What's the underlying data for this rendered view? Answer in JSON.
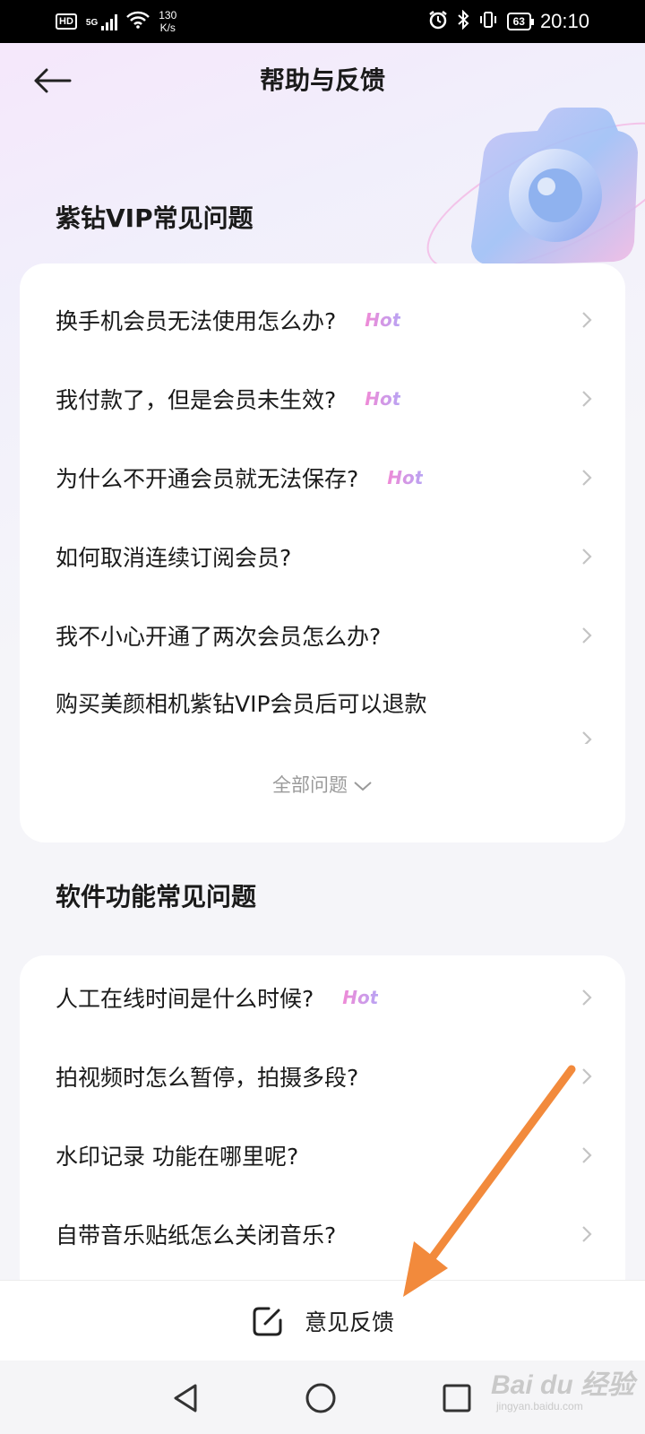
{
  "status_bar": {
    "hd": "HD",
    "network": "5G",
    "speed_value": "130",
    "speed_unit": "K/s",
    "battery": "63",
    "time": "20:10"
  },
  "header": {
    "title": "帮助与反馈",
    "back_icon": "back-arrow-icon"
  },
  "vip_section": {
    "title": "紫钻VIP常见问题",
    "hot_label": "Hot",
    "items": [
      {
        "text": "换手机会员无法使用怎么办?",
        "hot": true
      },
      {
        "text": "我付款了，但是会员未生效?",
        "hot": true
      },
      {
        "text": "为什么不开通会员就无法保存?",
        "hot": true
      },
      {
        "text": "如何取消连续订阅会员?",
        "hot": false
      },
      {
        "text": "我不小心开通了两次会员怎么办?",
        "hot": false
      },
      {
        "text": "购买美颜相机紫钻VIP会员后可以退款",
        "hot": false
      }
    ],
    "all_questions_label": "全部问题"
  },
  "software_section": {
    "title": "软件功能常见问题",
    "items": [
      {
        "text": "人工在线时间是什么时候?",
        "hot": true
      },
      {
        "text": "拍视频时怎么暂停，拍摄多段?",
        "hot": false
      },
      {
        "text": "水印记录 功能在哪里呢?",
        "hot": false
      },
      {
        "text": "自带音乐贴纸怎么关闭音乐?",
        "hot": false
      }
    ]
  },
  "footer": {
    "feedback_label": "意见反馈",
    "feedback_icon": "edit-icon"
  },
  "watermark": {
    "brand": "Bai du 经验",
    "url": "jingyan.baidu.com"
  },
  "colors": {
    "annotation_arrow": "#f28a3c",
    "hot_gradient_start": "#f08ad6",
    "hot_gradient_end": "#b9a3f3"
  }
}
